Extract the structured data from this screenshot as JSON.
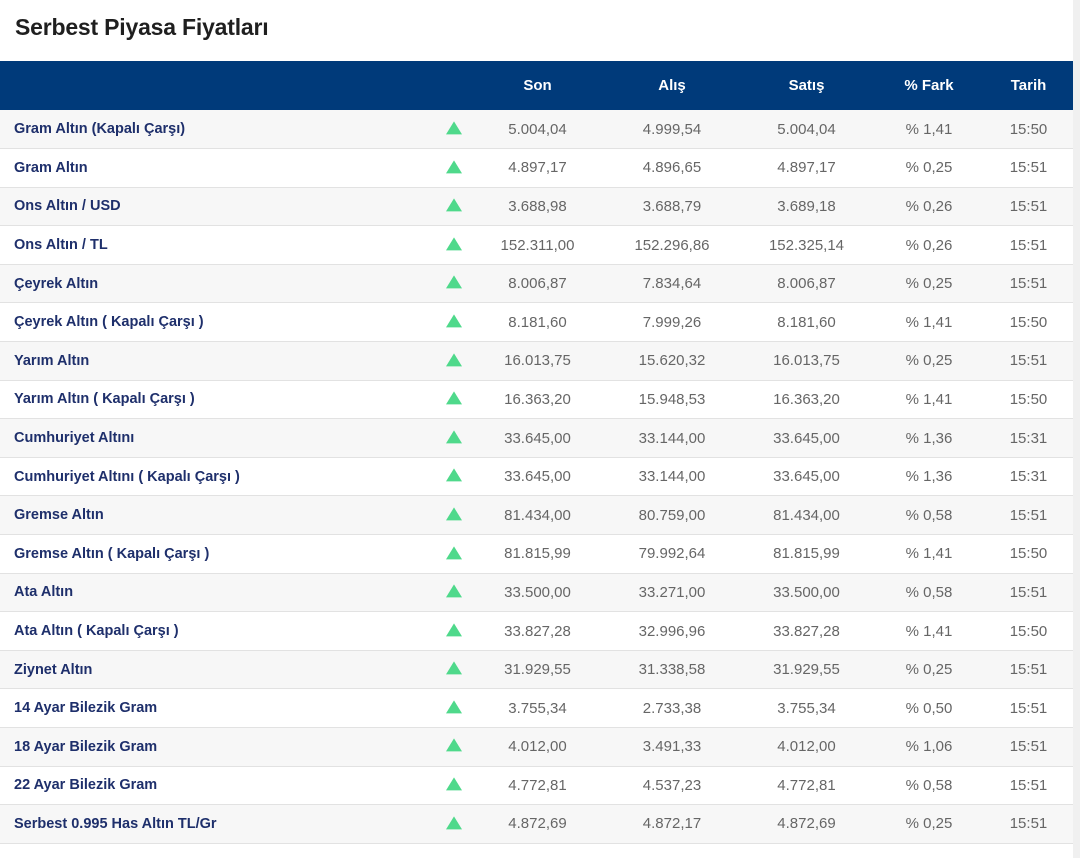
{
  "page": {
    "title": "Serbest Piyasa Fiyatları"
  },
  "table": {
    "headers": {
      "name": "",
      "son": "Son",
      "alis": "Alış",
      "satis": "Satış",
      "fark": "% Fark",
      "tarih": "Tarih"
    },
    "trend_icon": "arrow-up-icon",
    "trend_color": "#4fd98b",
    "rows": [
      {
        "name": "Gram Altın (Kapalı Çarşı)",
        "son": "5.004,04",
        "alis": "4.999,54",
        "satis": "5.004,04",
        "fark": "% 1,41",
        "tarih": "15:50"
      },
      {
        "name": "Gram Altın",
        "son": "4.897,17",
        "alis": "4.896,65",
        "satis": "4.897,17",
        "fark": "% 0,25",
        "tarih": "15:51"
      },
      {
        "name": "Ons Altın / USD",
        "son": "3.688,98",
        "alis": "3.688,79",
        "satis": "3.689,18",
        "fark": "% 0,26",
        "tarih": "15:51"
      },
      {
        "name": "Ons Altın / TL",
        "son": "152.311,00",
        "alis": "152.296,86",
        "satis": "152.325,14",
        "fark": "% 0,26",
        "tarih": "15:51"
      },
      {
        "name": "Çeyrek Altın",
        "son": "8.006,87",
        "alis": "7.834,64",
        "satis": "8.006,87",
        "fark": "% 0,25",
        "tarih": "15:51"
      },
      {
        "name": "Çeyrek Altın ( Kapalı Çarşı )",
        "son": "8.181,60",
        "alis": "7.999,26",
        "satis": "8.181,60",
        "fark": "% 1,41",
        "tarih": "15:50"
      },
      {
        "name": "Yarım Altın",
        "son": "16.013,75",
        "alis": "15.620,32",
        "satis": "16.013,75",
        "fark": "% 0,25",
        "tarih": "15:51"
      },
      {
        "name": "Yarım Altın ( Kapalı Çarşı )",
        "son": "16.363,20",
        "alis": "15.948,53",
        "satis": "16.363,20",
        "fark": "% 1,41",
        "tarih": "15:50"
      },
      {
        "name": "Cumhuriyet Altını",
        "son": "33.645,00",
        "alis": "33.144,00",
        "satis": "33.645,00",
        "fark": "% 1,36",
        "tarih": "15:31"
      },
      {
        "name": "Cumhuriyet Altını ( Kapalı Çarşı )",
        "son": "33.645,00",
        "alis": "33.144,00",
        "satis": "33.645,00",
        "fark": "% 1,36",
        "tarih": "15:31"
      },
      {
        "name": "Gremse Altın",
        "son": "81.434,00",
        "alis": "80.759,00",
        "satis": "81.434,00",
        "fark": "% 0,58",
        "tarih": "15:51"
      },
      {
        "name": "Gremse Altın ( Kapalı Çarşı )",
        "son": "81.815,99",
        "alis": "79.992,64",
        "satis": "81.815,99",
        "fark": "% 1,41",
        "tarih": "15:50"
      },
      {
        "name": "Ata Altın",
        "son": "33.500,00",
        "alis": "33.271,00",
        "satis": "33.500,00",
        "fark": "% 0,58",
        "tarih": "15:51"
      },
      {
        "name": "Ata Altın ( Kapalı Çarşı )",
        "son": "33.827,28",
        "alis": "32.996,96",
        "satis": "33.827,28",
        "fark": "% 1,41",
        "tarih": "15:50"
      },
      {
        "name": "Ziynet Altın",
        "son": "31.929,55",
        "alis": "31.338,58",
        "satis": "31.929,55",
        "fark": "% 0,25",
        "tarih": "15:51"
      },
      {
        "name": "14 Ayar Bilezik Gram",
        "son": "3.755,34",
        "alis": "2.733,38",
        "satis": "3.755,34",
        "fark": "% 0,50",
        "tarih": "15:51"
      },
      {
        "name": "18 Ayar Bilezik Gram",
        "son": "4.012,00",
        "alis": "3.491,33",
        "satis": "4.012,00",
        "fark": "% 1,06",
        "tarih": "15:51"
      },
      {
        "name": "22 Ayar Bilezik Gram",
        "son": "4.772,81",
        "alis": "4.537,23",
        "satis": "4.772,81",
        "fark": "% 0,58",
        "tarih": "15:51"
      },
      {
        "name": "Serbest 0.995 Has Altın TL/Gr",
        "son": "4.872,69",
        "alis": "4.872,17",
        "satis": "4.872,69",
        "fark": "% 0,25",
        "tarih": "15:51"
      }
    ]
  }
}
